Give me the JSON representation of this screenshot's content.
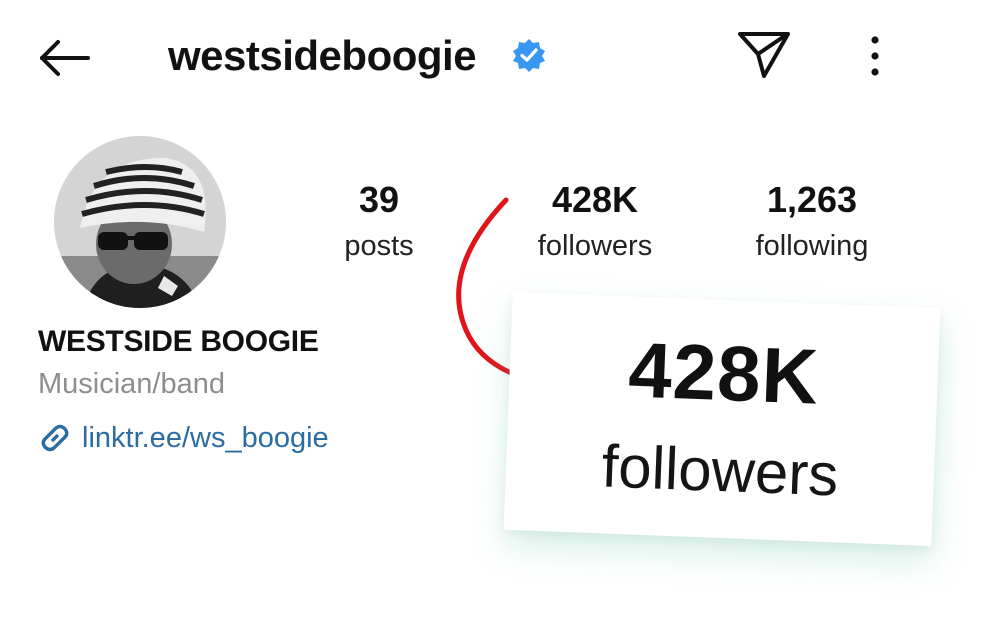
{
  "header": {
    "username": "westsideboogie",
    "verified": true,
    "icons": {
      "back": "back-arrow-icon",
      "verified": "verified-badge-icon",
      "share": "send-icon",
      "more": "more-options-icon"
    }
  },
  "profile": {
    "avatar": "profile-photo",
    "display_name": "WESTSIDE BOOGIE",
    "category": "Musician/band",
    "link": "linktr.ee/ws_boogie",
    "link_icon": "link-icon"
  },
  "stats": {
    "posts": {
      "value": "39",
      "label": "posts"
    },
    "followers": {
      "value": "428K",
      "label": "followers"
    },
    "following": {
      "value": "1,263",
      "label": "following"
    }
  },
  "callout": {
    "value": "428K",
    "label": "followers"
  },
  "colors": {
    "text": "#111111",
    "secondary": "#8e8e8e",
    "link": "#2b6ca3",
    "verified": "#3897f0",
    "arrow": "#e0141b",
    "callout_shadow": "#78d2b4"
  }
}
